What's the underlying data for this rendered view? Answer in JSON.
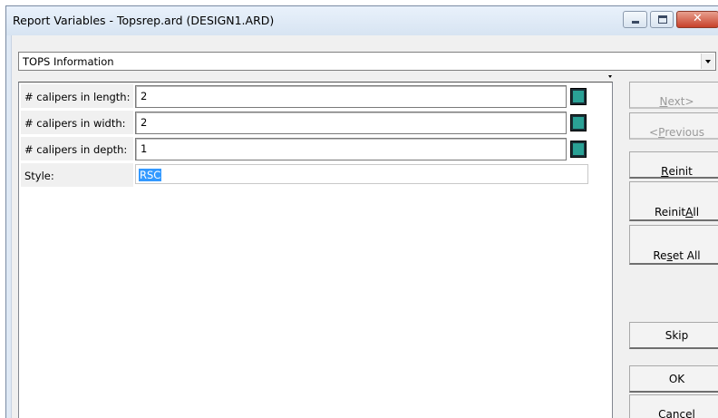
{
  "window": {
    "title": "Report Variables - Topsrep.ard (DESIGN1.ARD)"
  },
  "combo": {
    "selected": "TOPS Information"
  },
  "variables": [
    {
      "label": "# calipers in length:",
      "value": "2"
    },
    {
      "label": "# calipers in width:",
      "value": "2"
    },
    {
      "label": "# calipers in depth:",
      "value": "1"
    }
  ],
  "style": {
    "label": "Style:",
    "value": "RSC"
  },
  "buttons": {
    "next": {
      "pre": "",
      "key": "N",
      "post": "ext>"
    },
    "previous": {
      "pre": "<",
      "key": "P",
      "post": "revious"
    },
    "reinit": {
      "pre": "",
      "key": "R",
      "post": "einit"
    },
    "reinit_all": {
      "pre": "Reinit ",
      "key": "A",
      "post": "ll"
    },
    "reset_all": {
      "pre": "Re",
      "key": "s",
      "post": "et All"
    },
    "skip": "Skip",
    "ok": "OK",
    "cancel": {
      "pre": "",
      "key": "C",
      "post": "ancel"
    }
  },
  "colors": {
    "selection": "#3399ff",
    "picker_button": "#2aa195",
    "close_button": "#c7412a"
  },
  "icons": [
    "minimize-icon",
    "maximize-icon",
    "close-icon",
    "dropdown-arrow-icon",
    "picker-icon"
  ]
}
